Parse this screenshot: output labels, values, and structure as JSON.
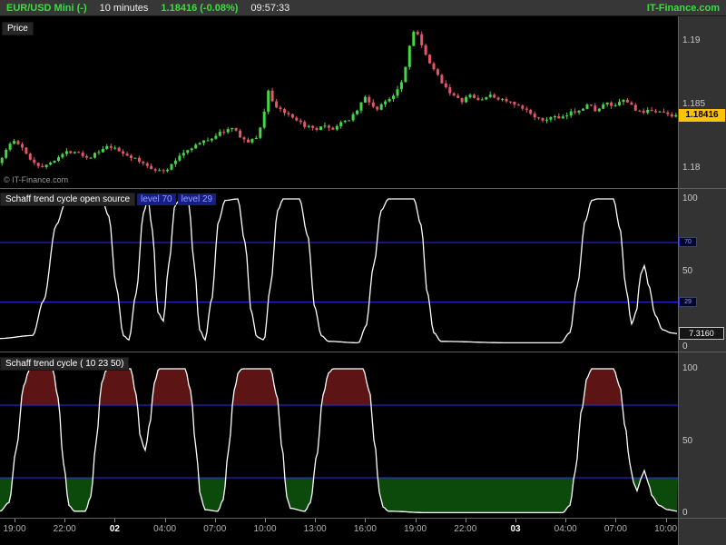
{
  "header": {
    "symbol": "EUR/USD Mini (-)",
    "timeframe": "10 minutes",
    "quote": "1.18416 (-0.08%)",
    "clock": "09:57:33",
    "brand": "IT-Finance.com"
  },
  "price_panel": {
    "label": "Price",
    "watermark": "© IT-Finance.com",
    "axis": [
      "1.19",
      "1.185",
      "1.18"
    ],
    "last_price_label": "1.18416"
  },
  "stc_open_panel": {
    "title": "Schaff trend cycle open source",
    "level_label_1": "level 70",
    "level_label_2": "level 29",
    "axis": [
      "100",
      "50",
      "0"
    ],
    "level_box_1": "70",
    "level_box_2": "29",
    "value_box": "7.3160"
  },
  "stc_panel": {
    "title": "Schaff trend cycle ( 10 23 50)",
    "axis": [
      "100",
      "50",
      "0"
    ]
  },
  "time_axis": [
    {
      "label": "19:00",
      "bold": false
    },
    {
      "label": "22:00",
      "bold": false
    },
    {
      "label": "02",
      "bold": true
    },
    {
      "label": "04:00",
      "bold": false
    },
    {
      "label": "07:00",
      "bold": false
    },
    {
      "label": "10:00",
      "bold": false
    },
    {
      "label": "13:00",
      "bold": false
    },
    {
      "label": "16:00",
      "bold": false
    },
    {
      "label": "19:00",
      "bold": false
    },
    {
      "label": "22:00",
      "bold": false
    },
    {
      "label": "03",
      "bold": true
    },
    {
      "label": "04:00",
      "bold": false
    },
    {
      "label": "07:00",
      "bold": false
    },
    {
      "label": "10:00",
      "bold": false
    }
  ],
  "colors": {
    "up": "#45d845",
    "down": "#e5556a",
    "curve": "#ffffff",
    "level_line": "#2e2ee6",
    "fill_above": "#5c1414",
    "fill_below": "#0c4a0c",
    "price_tag_bg": "#fdc300",
    "accent_green": "#3ddc3d"
  },
  "chart_data": [
    {
      "type": "candlestick",
      "title": "EUR/USD Mini, 10 minutes",
      "ylabel": "Price",
      "ylim": [
        1.17843,
        1.19193
      ],
      "yticks": [
        1.18,
        1.185,
        1.19
      ],
      "last_close": 1.18416,
      "candle_count": 168,
      "xticks": [
        "19:00",
        "22:00",
        "02",
        "04:00",
        "07:00",
        "10:00",
        "13:00",
        "16:00",
        "19:00",
        "22:00",
        "03",
        "04:00",
        "07:00",
        "10:00"
      ],
      "anchors": [
        [
          0,
          1.1804
        ],
        [
          8,
          1.1813
        ],
        [
          16,
          1.1822
        ],
        [
          24,
          1.1818
        ],
        [
          32,
          1.181
        ],
        [
          42,
          1.1803
        ],
        [
          52,
          1.1801
        ],
        [
          62,
          1.1807
        ],
        [
          74,
          1.1812
        ],
        [
          86,
          1.1814
        ],
        [
          98,
          1.1808
        ],
        [
          110,
          1.1812
        ],
        [
          122,
          1.1817
        ],
        [
          134,
          1.1813
        ],
        [
          146,
          1.1809
        ],
        [
          158,
          1.1804
        ],
        [
          170,
          1.18
        ],
        [
          182,
          1.1797
        ],
        [
          190,
          1.1801
        ],
        [
          200,
          1.181
        ],
        [
          212,
          1.1816
        ],
        [
          224,
          1.182
        ],
        [
          236,
          1.1824
        ],
        [
          248,
          1.1829
        ],
        [
          258,
          1.1831
        ],
        [
          266,
          1.1826
        ],
        [
          274,
          1.182
        ],
        [
          284,
          1.1823
        ],
        [
          292,
          1.1838
        ],
        [
          298,
          1.1862
        ],
        [
          304,
          1.1849
        ],
        [
          312,
          1.1846
        ],
        [
          320,
          1.1841
        ],
        [
          330,
          1.1836
        ],
        [
          340,
          1.1833
        ],
        [
          350,
          1.1829
        ],
        [
          358,
          1.1833
        ],
        [
          366,
          1.183
        ],
        [
          376,
          1.1834
        ],
        [
          386,
          1.1838
        ],
        [
          396,
          1.1846
        ],
        [
          404,
          1.1856
        ],
        [
          410,
          1.1851
        ],
        [
          418,
          1.1846
        ],
        [
          428,
          1.1853
        ],
        [
          436,
          1.1858
        ],
        [
          444,
          1.1867
        ],
        [
          450,
          1.1882
        ],
        [
          456,
          1.1906
        ],
        [
          460,
          1.1911
        ],
        [
          466,
          1.1897
        ],
        [
          472,
          1.1887
        ],
        [
          480,
          1.1877
        ],
        [
          490,
          1.1867
        ],
        [
          500,
          1.1858
        ],
        [
          510,
          1.1852
        ],
        [
          520,
          1.1857
        ],
        [
          530,
          1.1853
        ],
        [
          540,
          1.1857
        ],
        [
          550,
          1.1855
        ],
        [
          560,
          1.1853
        ],
        [
          570,
          1.1849
        ],
        [
          580,
          1.1846
        ],
        [
          590,
          1.1842
        ],
        [
          600,
          1.1836
        ],
        [
          610,
          1.1841
        ],
        [
          620,
          1.1838
        ],
        [
          630,
          1.1843
        ],
        [
          640,
          1.1846
        ],
        [
          650,
          1.185
        ],
        [
          660,
          1.1845
        ],
        [
          670,
          1.1851
        ],
        [
          680,
          1.1848
        ],
        [
          690,
          1.1854
        ],
        [
          700,
          1.1848
        ],
        [
          710,
          1.1842
        ],
        [
          720,
          1.1846
        ],
        [
          730,
          1.1844
        ],
        [
          740,
          1.18416
        ],
        [
          747,
          1.18416
        ]
      ]
    },
    {
      "type": "line",
      "title": "Schaff trend cycle open source",
      "ylim": [
        0,
        100
      ],
      "levels": [
        70,
        29
      ],
      "last_value": 7.316,
      "keyframes": [
        [
          0,
          4
        ],
        [
          36,
          6
        ],
        [
          48,
          30
        ],
        [
          62,
          82
        ],
        [
          72,
          97
        ],
        [
          80,
          100
        ],
        [
          112,
          100
        ],
        [
          120,
          88
        ],
        [
          128,
          40
        ],
        [
          136,
          6
        ],
        [
          142,
          3
        ],
        [
          150,
          35
        ],
        [
          158,
          90
        ],
        [
          163,
          100
        ],
        [
          168,
          78
        ],
        [
          174,
          22
        ],
        [
          180,
          16
        ],
        [
          186,
          55
        ],
        [
          193,
          96
        ],
        [
          199,
          100
        ],
        [
          208,
          97
        ],
        [
          214,
          55
        ],
        [
          220,
          10
        ],
        [
          226,
          3
        ],
        [
          233,
          30
        ],
        [
          241,
          85
        ],
        [
          248,
          99
        ],
        [
          262,
          100
        ],
        [
          270,
          70
        ],
        [
          277,
          22
        ],
        [
          283,
          5
        ],
        [
          291,
          3
        ],
        [
          298,
          40
        ],
        [
          306,
          92
        ],
        [
          312,
          100
        ],
        [
          330,
          100
        ],
        [
          339,
          75
        ],
        [
          347,
          25
        ],
        [
          354,
          6
        ],
        [
          362,
          2
        ],
        [
          395,
          1
        ],
        [
          403,
          12
        ],
        [
          412,
          55
        ],
        [
          420,
          92
        ],
        [
          428,
          100
        ],
        [
          456,
          100
        ],
        [
          464,
          82
        ],
        [
          471,
          35
        ],
        [
          478,
          8
        ],
        [
          486,
          2
        ],
        [
          560,
          1
        ],
        [
          618,
          1
        ],
        [
          628,
          8
        ],
        [
          636,
          40
        ],
        [
          645,
          85
        ],
        [
          652,
          99
        ],
        [
          658,
          100
        ],
        [
          676,
          100
        ],
        [
          683,
          80
        ],
        [
          690,
          38
        ],
        [
          696,
          14
        ],
        [
          701,
          22
        ],
        [
          706,
          48
        ],
        [
          710,
          54
        ],
        [
          715,
          40
        ],
        [
          722,
          20
        ],
        [
          730,
          10
        ],
        [
          740,
          7.8
        ],
        [
          747,
          7.3
        ]
      ]
    },
    {
      "type": "line",
      "title": "Schaff trend cycle ( 10 23 50)",
      "ylim": [
        0,
        100
      ],
      "levels": [
        75,
        25
      ],
      "fill_above_level": 75,
      "fill_below_level": 25,
      "keyframes": [
        [
          0,
          2
        ],
        [
          10,
          8
        ],
        [
          18,
          45
        ],
        [
          26,
          88
        ],
        [
          32,
          99
        ],
        [
          36,
          100
        ],
        [
          58,
          100
        ],
        [
          64,
          80
        ],
        [
          70,
          35
        ],
        [
          76,
          6
        ],
        [
          82,
          2
        ],
        [
          94,
          2
        ],
        [
          100,
          12
        ],
        [
          106,
          50
        ],
        [
          112,
          90
        ],
        [
          117,
          99
        ],
        [
          121,
          100
        ],
        [
          144,
          100
        ],
        [
          150,
          82
        ],
        [
          155,
          52
        ],
        [
          160,
          44
        ],
        [
          165,
          62
        ],
        [
          170,
          90
        ],
        [
          175,
          100
        ],
        [
          204,
          100
        ],
        [
          210,
          85
        ],
        [
          216,
          45
        ],
        [
          221,
          12
        ],
        [
          226,
          3
        ],
        [
          240,
          2
        ],
        [
          246,
          10
        ],
        [
          252,
          45
        ],
        [
          258,
          85
        ],
        [
          263,
          98
        ],
        [
          267,
          100
        ],
        [
          298,
          100
        ],
        [
          305,
          82
        ],
        [
          311,
          45
        ],
        [
          316,
          12
        ],
        [
          320,
          4
        ],
        [
          336,
          2
        ],
        [
          342,
          8
        ],
        [
          349,
          40
        ],
        [
          356,
          82
        ],
        [
          362,
          97
        ],
        [
          367,
          100
        ],
        [
          400,
          100
        ],
        [
          407,
          85
        ],
        [
          413,
          48
        ],
        [
          418,
          15
        ],
        [
          422,
          5
        ],
        [
          428,
          2
        ],
        [
          470,
          1
        ],
        [
          620,
          1
        ],
        [
          628,
          6
        ],
        [
          634,
          30
        ],
        [
          641,
          72
        ],
        [
          647,
          94
        ],
        [
          652,
          100
        ],
        [
          676,
          100
        ],
        [
          683,
          88
        ],
        [
          689,
          60
        ],
        [
          694,
          35
        ],
        [
          698,
          22
        ],
        [
          702,
          16
        ],
        [
          706,
          24
        ],
        [
          710,
          30
        ],
        [
          714,
          22
        ],
        [
          719,
          12
        ],
        [
          726,
          6
        ],
        [
          736,
          3
        ],
        [
          747,
          2
        ]
      ]
    }
  ]
}
